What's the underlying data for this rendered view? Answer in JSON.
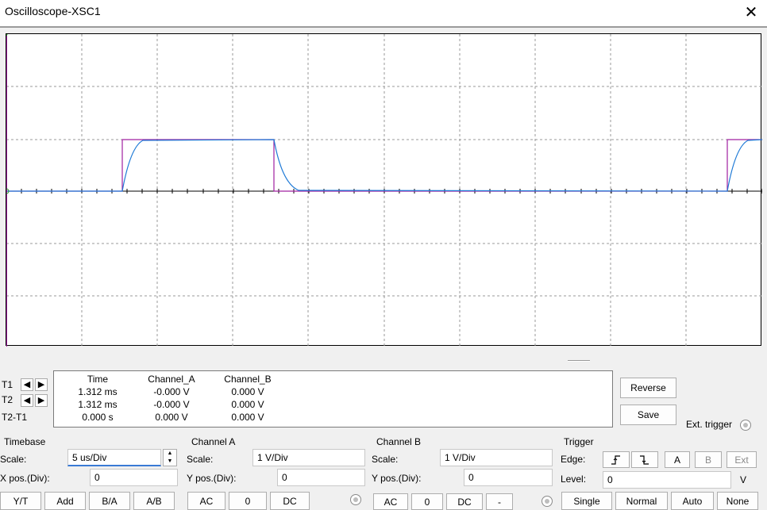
{
  "window": {
    "title": "Oscilloscope-XSC1",
    "close_label": "✕"
  },
  "cursors": {
    "t1_label": "T1",
    "t2_label": "T2",
    "t2t1_label": "T2-T1"
  },
  "readout": {
    "headers": [
      "Time",
      "Channel_A",
      "Channel_B"
    ],
    "rows": [
      [
        "1.312 ms",
        "-0.000 V",
        "0.000 V"
      ],
      [
        "1.312 ms",
        "-0.000 V",
        "0.000 V"
      ],
      [
        "0.000 s",
        "0.000 V",
        "0.000 V"
      ]
    ]
  },
  "actions": {
    "reverse_label": "Reverse",
    "save_label": "Save",
    "ext_trigger_label": "Ext. trigger"
  },
  "timebase": {
    "title": "Timebase",
    "scale_label": "Scale:",
    "scale_value": "5 us/Div",
    "xpos_label": "X pos.(Div):",
    "xpos_value": "0",
    "buttons": [
      "Y/T",
      "Add",
      "B/A",
      "A/B"
    ]
  },
  "channel_a": {
    "title": "Channel A",
    "scale_label": "Scale:",
    "scale_value": "1  V/Div",
    "ypos_label": "Y pos.(Div):",
    "ypos_value": "0",
    "buttons": [
      "AC",
      "0",
      "DC"
    ]
  },
  "channel_b": {
    "title": "Channel B",
    "scale_label": "Scale:",
    "scale_value": "1  V/Div",
    "ypos_label": "Y pos.(Div):",
    "ypos_value": "0",
    "buttons": [
      "AC",
      "0",
      "DC",
      "-"
    ]
  },
  "trigger": {
    "title": "Trigger",
    "edge_label": "Edge:",
    "edge_buttons": [
      "rising-edge",
      "falling-edge"
    ],
    "source_buttons": [
      "A",
      "B",
      "Ext"
    ],
    "level_label": "Level:",
    "level_value": "0",
    "level_unit": "V",
    "mode_buttons": [
      "Single",
      "Normal",
      "Auto",
      "None"
    ]
  },
  "colors": {
    "channel_a_trace": "#a020a0",
    "channel_b_trace": "#1f7ad6",
    "grid": "#9a9a9a"
  }
}
